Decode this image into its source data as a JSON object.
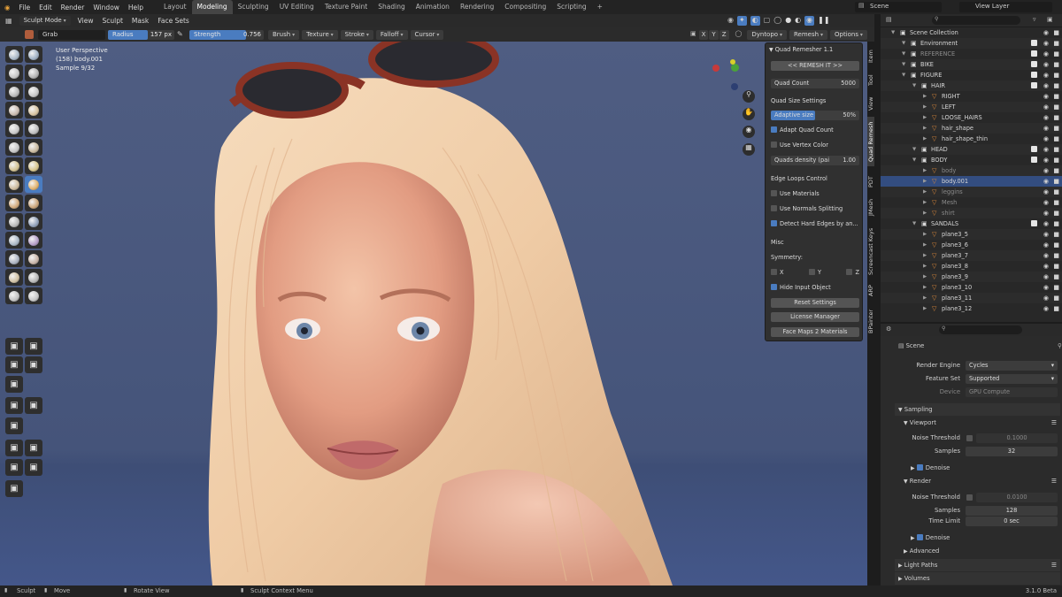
{
  "menu": {
    "items": [
      "File",
      "Edit",
      "Render",
      "Window",
      "Help"
    ]
  },
  "workspaces": {
    "tabs": [
      "Layout",
      "Modeling",
      "Sculpting",
      "UV Editing",
      "Texture Paint",
      "Shading",
      "Animation",
      "Rendering",
      "Compositing",
      "Scripting"
    ],
    "active": "Modeling",
    "add_label": "+"
  },
  "scene": {
    "label": "Scene",
    "view_layer": "View Layer"
  },
  "header": {
    "mode": "Sculpt Mode",
    "menus": [
      "View",
      "Sculpt",
      "Mask",
      "Face Sets"
    ]
  },
  "toolbar": {
    "brush_name": "Grab",
    "radius_label": "Radius",
    "radius_value": "157 px",
    "strength_label": "Strength",
    "strength_value": "0.756",
    "strength_fraction": 0.756,
    "dropdowns": [
      "Brush",
      "Texture",
      "Stroke",
      "Falloff",
      "Cursor"
    ],
    "axes": [
      "X",
      "Y",
      "Z"
    ],
    "right": [
      "Dyntopo",
      "Remesh",
      "Options"
    ]
  },
  "viewport": {
    "perspective": "User Perspective",
    "object": "(158) body.001",
    "sample": "Sample 9/32"
  },
  "quad_remesher": {
    "title": "Quad Remesher 1.1",
    "remesh_button": "<< REMESH IT >>",
    "quad_count_label": "Quad Count",
    "quad_count_value": "5000",
    "quad_size_settings": "Quad Size Settings",
    "adaptive_size_label": "Adaptive size",
    "adaptive_size_value": "50%",
    "adaptive_fraction": 0.5,
    "adapt_quad_count": "Adapt Quad Count",
    "use_vertex_color": "Use Vertex Color",
    "quads_density_label": "Quads density (pai",
    "quads_density_value": "1.00",
    "edge_loops_control": "Edge Loops Control",
    "use_materials": "Use Materials",
    "use_normals_splitting": "Use Normals Splitting",
    "detect_hard_edges": "Detect Hard Edges by an...",
    "misc": "Misc",
    "symmetry": "Symmetry:",
    "sym_axes": [
      "X",
      "Y",
      "Z"
    ],
    "hide_input_object": "Hide Input Object",
    "reset_settings": "Reset Settings",
    "license_manager": "License Manager",
    "face_maps": "Face Maps 2 Materials"
  },
  "side_tabs": [
    "Item",
    "Tool",
    "View",
    "Quad Remesh",
    "PDT",
    "JMesh",
    "Screencast Keys",
    "ARP",
    "BPainter"
  ],
  "outliner": {
    "rows": [
      {
        "name": "Scene Collection",
        "indent": 0
      },
      {
        "name": "Environment",
        "indent": 1
      },
      {
        "name": "REFERENCE",
        "indent": 1
      },
      {
        "name": "BIKE",
        "indent": 1
      },
      {
        "name": "FIGURE",
        "indent": 1
      },
      {
        "name": "HAIR",
        "indent": 2
      },
      {
        "name": "RIGHT",
        "indent": 3
      },
      {
        "name": "LEFT",
        "indent": 3
      },
      {
        "name": "LOOSE_HAIRS",
        "indent": 3
      },
      {
        "name": "hair_shape",
        "indent": 3
      },
      {
        "name": "hair_shape_thin",
        "indent": 3
      },
      {
        "name": "HEAD",
        "indent": 2
      },
      {
        "name": "BODY",
        "indent": 2
      },
      {
        "name": "body",
        "indent": 3
      },
      {
        "name": "body.001",
        "indent": 3
      },
      {
        "name": "leggins",
        "indent": 3
      },
      {
        "name": "Mesh",
        "indent": 3
      },
      {
        "name": "shirt",
        "indent": 3
      },
      {
        "name": "SANDALS",
        "indent": 2
      },
      {
        "name": "plane3_5",
        "indent": 3
      },
      {
        "name": "plane3_6",
        "indent": 3
      },
      {
        "name": "plane3_7",
        "indent": 3
      },
      {
        "name": "plane3_8",
        "indent": 3
      },
      {
        "name": "plane3_9",
        "indent": 3
      },
      {
        "name": "plane3_10",
        "indent": 3
      },
      {
        "name": "plane3_11",
        "indent": 3
      },
      {
        "name": "plane3_12",
        "indent": 3
      }
    ]
  },
  "properties": {
    "scene_label": "Scene",
    "render_engine_label": "Render Engine",
    "render_engine_value": "Cycles",
    "feature_set_label": "Feature Set",
    "feature_set_value": "Supported",
    "device_label": "Device",
    "device_value": "GPU Compute",
    "sampling": "Sampling",
    "viewport": "Viewport",
    "noise_threshold_label": "Noise Threshold",
    "viewport_noise_value": "0.1000",
    "samples_label": "Samples",
    "viewport_samples": "32",
    "denoise": "Denoise",
    "render": "Render",
    "render_noise_value": "0.0100",
    "render_samples": "128",
    "time_limit_label": "Time Limit",
    "time_limit_value": "0 sec",
    "advanced": "Advanced",
    "light_paths": "Light Paths",
    "volumes": "Volumes"
  },
  "status": {
    "sculpt": "Sculpt",
    "move": "Move",
    "rotate": "Rotate View",
    "context_menu": "Sculpt Context Menu",
    "version": "3.1.0 Beta"
  }
}
